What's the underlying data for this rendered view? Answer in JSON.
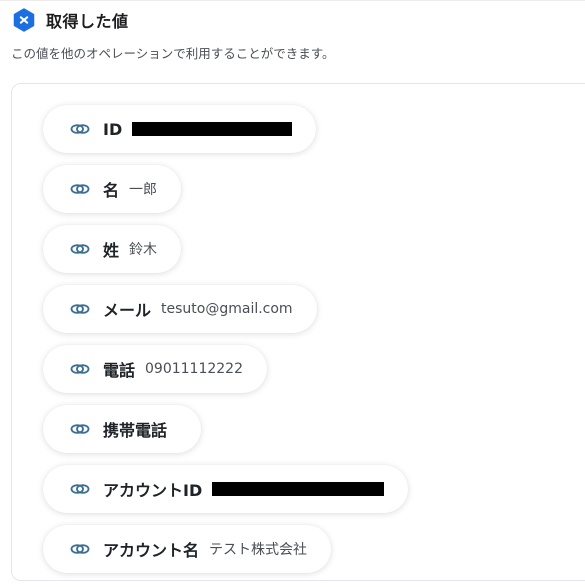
{
  "header": {
    "title": "取得した値",
    "subtitle": "この値を他のオペレーションで利用することができます。",
    "icon": "close-hexagon-icon",
    "accent": "#1b6fe0"
  },
  "fields": [
    {
      "label": "ID",
      "value": "",
      "redacted": true
    },
    {
      "label": "名",
      "value": "一郎"
    },
    {
      "label": "姓",
      "value": "鈴木"
    },
    {
      "label": "メール",
      "value": "tesuto@gmail.com"
    },
    {
      "label": "電話",
      "value": "09011112222"
    },
    {
      "label": "携帯電話",
      "value": ""
    },
    {
      "label": "アカウントID",
      "value": "",
      "redacted": true
    },
    {
      "label": "アカウント名",
      "value": "テスト株式会社"
    }
  ],
  "colors": {
    "link_icon": "#3d6e93",
    "panel_border": "#e4e6e9"
  }
}
